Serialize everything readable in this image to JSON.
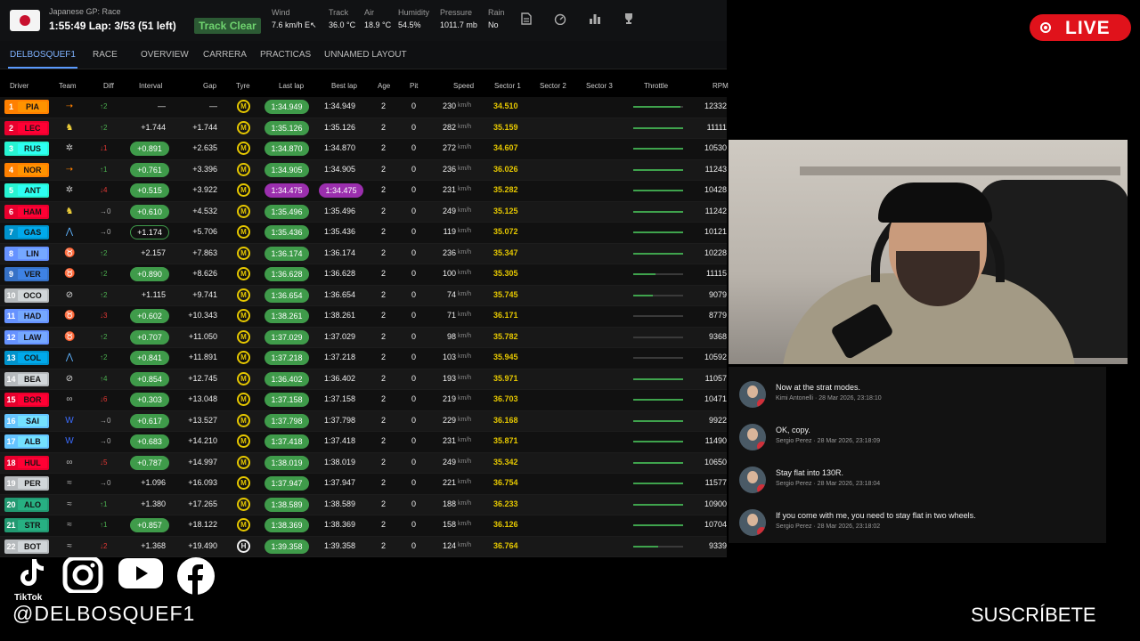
{
  "header": {
    "session": "Japanese GP: Race",
    "lap_info": "1:55:49 Lap: 3/53 (51 left)",
    "track_status": "Track Clear",
    "weather": [
      {
        "label": "Wind",
        "value": "7.6 km/h E↖"
      },
      {
        "label": "Track",
        "value": "36.0 °C"
      },
      {
        "label": "Air",
        "value": "18.9 °C"
      },
      {
        "label": "Humidity",
        "value": "54.5%"
      },
      {
        "label": "Pressure",
        "value": "1011.7 mb"
      },
      {
        "label": "Rain",
        "value": "No"
      }
    ],
    "icons": [
      "document-icon",
      "speedometer-icon",
      "bar-chart-icon",
      "trophy-icon"
    ]
  },
  "tabs": [
    "DELBOSQUEF1",
    "RACE",
    "OVERVIEW",
    "CARRERA",
    "PRACTICAS",
    "UNNAMED LAYOUT"
  ],
  "columns": [
    "Driver",
    "Team",
    "Diff",
    "Interval",
    "Gap",
    "Tyre",
    "Last lap",
    "Best lap",
    "Age",
    "Pit",
    "Speed",
    "Sector 1",
    "Sector 2",
    "Sector 3",
    "Throttle",
    "RPM"
  ],
  "speed_unit": "km/h",
  "rows": [
    {
      "pos": "1",
      "code": "PIA",
      "color": "#ff8000",
      "team_icon": "papaya-wing-icon",
      "diff": "↑2",
      "diff_dir": "up",
      "interval": "—",
      "interval_style": "plain",
      "gap": "—",
      "tyre": "M",
      "last": "1:34.949",
      "last_style": "green",
      "best": "1:34.949",
      "best_style": "plain",
      "age": "2",
      "pit": "0",
      "speed": "230",
      "s1": "34.510",
      "s1_style": "yellow",
      "throttle": 0.95,
      "rpm": "12332"
    },
    {
      "pos": "2",
      "code": "LEC",
      "color": "#e8002d",
      "team_icon": "prancing-horse-icon",
      "diff": "↑2",
      "diff_dir": "up",
      "interval": "+1.744",
      "interval_style": "plain",
      "gap": "+1.744",
      "tyre": "M",
      "last": "1:35.126",
      "last_style": "green",
      "best": "1:35.126",
      "best_style": "plain",
      "age": "2",
      "pit": "0",
      "speed": "282",
      "s1": "35.159",
      "s1_style": "yellow",
      "throttle": 1.0,
      "rpm": "11111"
    },
    {
      "pos": "3",
      "code": "RUS",
      "color": "#27f4d2",
      "team_icon": "star-icon",
      "diff": "↓1",
      "diff_dir": "down",
      "interval": "+0.891",
      "interval_style": "green",
      "gap": "+2.635",
      "tyre": "M",
      "last": "1:34.870",
      "last_style": "green",
      "best": "1:34.870",
      "best_style": "plain",
      "age": "2",
      "pit": "0",
      "speed": "272",
      "s1": "34.607",
      "s1_style": "yellow",
      "throttle": 1.0,
      "rpm": "10530"
    },
    {
      "pos": "4",
      "code": "NOR",
      "color": "#ff8000",
      "team_icon": "papaya-wing-icon",
      "diff": "↑1",
      "diff_dir": "up",
      "interval": "+0.761",
      "interval_style": "green",
      "gap": "+3.396",
      "tyre": "M",
      "last": "1:34.905",
      "last_style": "green",
      "best": "1:34.905",
      "best_style": "plain",
      "age": "2",
      "pit": "0",
      "speed": "236",
      "s1": "36.026",
      "s1_style": "yellow",
      "throttle": 1.0,
      "rpm": "11243"
    },
    {
      "pos": "5",
      "code": "ANT",
      "color": "#27f4d2",
      "team_icon": "star-icon",
      "diff": "↓4",
      "diff_dir": "down",
      "interval": "+0.515",
      "interval_style": "green",
      "gap": "+3.922",
      "tyre": "M",
      "last": "1:34.475",
      "last_style": "purple",
      "best": "1:34.475",
      "best_style": "purple",
      "age": "2",
      "pit": "0",
      "speed": "231",
      "s1": "35.282",
      "s1_style": "yellow",
      "throttle": 1.0,
      "rpm": "10428"
    },
    {
      "pos": "6",
      "code": "HAM",
      "color": "#e8002d",
      "team_icon": "prancing-horse-icon",
      "diff": "→0",
      "diff_dir": "same",
      "interval": "+0.610",
      "interval_style": "green",
      "gap": "+4.532",
      "tyre": "M",
      "last": "1:35.496",
      "last_style": "green",
      "best": "1:35.496",
      "best_style": "plain",
      "age": "2",
      "pit": "0",
      "speed": "249",
      "s1": "35.125",
      "s1_style": "yellow",
      "throttle": 1.0,
      "rpm": "11242"
    },
    {
      "pos": "7",
      "code": "GAS",
      "color": "#0093cc",
      "team_icon": "alpine-icon",
      "diff": "→0",
      "diff_dir": "same",
      "interval": "+1.174",
      "interval_style": "outline",
      "gap": "+5.706",
      "tyre": "M",
      "last": "1:35.436",
      "last_style": "green",
      "best": "1:35.436",
      "best_style": "plain",
      "age": "2",
      "pit": "0",
      "speed": "119",
      "s1": "35.072",
      "s1_style": "yellow",
      "throttle": 1.0,
      "rpm": "10121"
    },
    {
      "pos": "8",
      "code": "LIN",
      "color": "#6692ff",
      "team_icon": "bull-icon",
      "diff": "↑2",
      "diff_dir": "up",
      "interval": "+2.157",
      "interval_style": "plain",
      "gap": "+7.863",
      "tyre": "M",
      "last": "1:36.174",
      "last_style": "green",
      "best": "1:36.174",
      "best_style": "plain",
      "age": "2",
      "pit": "0",
      "speed": "236",
      "s1": "35.347",
      "s1_style": "yellow",
      "throttle": 1.0,
      "rpm": "10228"
    },
    {
      "pos": "9",
      "code": "VER",
      "color": "#3671c6",
      "team_icon": "bull-icon",
      "diff": "↑2",
      "diff_dir": "up",
      "interval": "+0.890",
      "interval_style": "green",
      "gap": "+8.626",
      "tyre": "M",
      "last": "1:36.628",
      "last_style": "green",
      "best": "1:36.628",
      "best_style": "plain",
      "age": "2",
      "pit": "0",
      "speed": "100",
      "s1": "35.305",
      "s1_style": "yellow",
      "throttle": 0.45,
      "rpm": "11115"
    },
    {
      "pos": "10",
      "code": "OCO",
      "color": "#b6babd",
      "team_icon": "haas-icon",
      "diff": "↑2",
      "diff_dir": "up",
      "interval": "+1.115",
      "interval_style": "plain",
      "gap": "+9.741",
      "tyre": "M",
      "last": "1:36.654",
      "last_style": "green",
      "best": "1:36.654",
      "best_style": "plain",
      "age": "2",
      "pit": "0",
      "speed": "74",
      "s1": "35.745",
      "s1_style": "yellow",
      "throttle": 0.4,
      "rpm": "9079"
    },
    {
      "pos": "11",
      "code": "HAD",
      "color": "#6692ff",
      "team_icon": "bull-icon",
      "diff": "↓3",
      "diff_dir": "down",
      "interval": "+0.602",
      "interval_style": "green",
      "gap": "+10.343",
      "tyre": "M",
      "last": "1:38.261",
      "last_style": "green",
      "best": "1:38.261",
      "best_style": "plain",
      "age": "2",
      "pit": "0",
      "speed": "71",
      "s1": "36.171",
      "s1_style": "yellow",
      "throttle": 0.0,
      "rpm": "8779"
    },
    {
      "pos": "12",
      "code": "LAW",
      "color": "#6692ff",
      "team_icon": "bull-icon",
      "diff": "↑2",
      "diff_dir": "up",
      "interval": "+0.707",
      "interval_style": "green",
      "gap": "+11.050",
      "tyre": "M",
      "last": "1:37.029",
      "last_style": "green",
      "best": "1:37.029",
      "best_style": "plain",
      "age": "2",
      "pit": "0",
      "speed": "98",
      "s1": "35.782",
      "s1_style": "yellow",
      "throttle": 0.0,
      "rpm": "9368"
    },
    {
      "pos": "13",
      "code": "COL",
      "color": "#0093cc",
      "team_icon": "alpine-icon",
      "diff": "↑2",
      "diff_dir": "up",
      "interval": "+0.841",
      "interval_style": "green",
      "gap": "+11.891",
      "tyre": "M",
      "last": "1:37.218",
      "last_style": "green",
      "best": "1:37.218",
      "best_style": "plain",
      "age": "2",
      "pit": "0",
      "speed": "103",
      "s1": "35.945",
      "s1_style": "yellow",
      "throttle": 0.0,
      "rpm": "10592"
    },
    {
      "pos": "14",
      "code": "BEA",
      "color": "#b6babd",
      "team_icon": "haas-icon",
      "diff": "↑4",
      "diff_dir": "up",
      "interval": "+0.854",
      "interval_style": "green",
      "gap": "+12.745",
      "tyre": "M",
      "last": "1:36.402",
      "last_style": "green",
      "best": "1:36.402",
      "best_style": "plain",
      "age": "2",
      "pit": "0",
      "speed": "193",
      "s1": "35.971",
      "s1_style": "yellow",
      "throttle": 1.0,
      "rpm": "11057"
    },
    {
      "pos": "15",
      "code": "BOR",
      "color": "#e8002d",
      "team_icon": "audi-icon",
      "diff": "↓6",
      "diff_dir": "down",
      "interval": "+0.303",
      "interval_style": "green",
      "gap": "+13.048",
      "tyre": "M",
      "last": "1:37.158",
      "last_style": "green",
      "best": "1:37.158",
      "best_style": "plain",
      "age": "2",
      "pit": "0",
      "speed": "219",
      "s1": "36.703",
      "s1_style": "yellow",
      "throttle": 1.0,
      "rpm": "10471"
    },
    {
      "pos": "16",
      "code": "SAI",
      "color": "#64c4ff",
      "team_icon": "williams-icon",
      "diff": "→0",
      "diff_dir": "same",
      "interval": "+0.617",
      "interval_style": "green",
      "gap": "+13.527",
      "tyre": "M",
      "last": "1:37.798",
      "last_style": "green",
      "best": "1:37.798",
      "best_style": "plain",
      "age": "2",
      "pit": "0",
      "speed": "229",
      "s1": "36.168",
      "s1_style": "yellow",
      "throttle": 1.0,
      "rpm": "9922"
    },
    {
      "pos": "17",
      "code": "ALB",
      "color": "#64c4ff",
      "team_icon": "williams-icon",
      "diff": "→0",
      "diff_dir": "same",
      "interval": "+0.683",
      "interval_style": "green",
      "gap": "+14.210",
      "tyre": "M",
      "last": "1:37.418",
      "last_style": "green",
      "best": "1:37.418",
      "best_style": "plain",
      "age": "2",
      "pit": "0",
      "speed": "231",
      "s1": "35.871",
      "s1_style": "yellow",
      "throttle": 1.0,
      "rpm": "11490"
    },
    {
      "pos": "18",
      "code": "HUL",
      "color": "#e8002d",
      "team_icon": "audi-icon",
      "diff": "↓5",
      "diff_dir": "down",
      "interval": "+0.787",
      "interval_style": "green",
      "gap": "+14.997",
      "tyre": "M",
      "last": "1:38.019",
      "last_style": "green",
      "best": "1:38.019",
      "best_style": "plain",
      "age": "2",
      "pit": "0",
      "speed": "249",
      "s1": "35.342",
      "s1_style": "yellow",
      "throttle": 1.0,
      "rpm": "10650"
    },
    {
      "pos": "19",
      "code": "PER",
      "color": "#b6babd",
      "team_icon": "cadillac-icon",
      "diff": "→0",
      "diff_dir": "same",
      "interval": "+1.096",
      "interval_style": "plain",
      "gap": "+16.093",
      "tyre": "M",
      "last": "1:37.947",
      "last_style": "green",
      "best": "1:37.947",
      "best_style": "plain",
      "age": "2",
      "pit": "0",
      "speed": "221",
      "s1": "36.754",
      "s1_style": "yellow",
      "throttle": 1.0,
      "rpm": "11577"
    },
    {
      "pos": "20",
      "code": "ALO",
      "color": "#229971",
      "team_icon": "aston-wing-icon",
      "diff": "↑1",
      "diff_dir": "up",
      "interval": "+1.380",
      "interval_style": "plain",
      "gap": "+17.265",
      "tyre": "M",
      "last": "1:38.589",
      "last_style": "green",
      "best": "1:38.589",
      "best_style": "plain",
      "age": "2",
      "pit": "0",
      "speed": "188",
      "s1": "36.233",
      "s1_style": "yellow",
      "throttle": 1.0,
      "rpm": "10900"
    },
    {
      "pos": "21",
      "code": "STR",
      "color": "#229971",
      "team_icon": "aston-wing-icon",
      "diff": "↑1",
      "diff_dir": "up",
      "interval": "+0.857",
      "interval_style": "green",
      "gap": "+18.122",
      "tyre": "M",
      "last": "1:38.369",
      "last_style": "green",
      "best": "1:38.369",
      "best_style": "plain",
      "age": "2",
      "pit": "0",
      "speed": "158",
      "s1": "36.126",
      "s1_style": "yellow",
      "throttle": 1.0,
      "rpm": "10704"
    },
    {
      "pos": "22",
      "code": "BOT",
      "color": "#b6babd",
      "team_icon": "cadillac-icon",
      "diff": "↓2",
      "diff_dir": "down",
      "interval": "+1.368",
      "interval_style": "plain",
      "gap": "+19.490",
      "tyre": "H",
      "last": "1:39.358",
      "last_style": "green",
      "best": "1:39.358",
      "best_style": "plain",
      "age": "2",
      "pit": "0",
      "speed": "124",
      "s1": "36.764",
      "s1_style": "yellow",
      "throttle": 0.5,
      "rpm": "9339"
    }
  ],
  "chat": [
    {
      "text": "Now at the strat modes.",
      "meta": "Kimi Antonelli · 28 Mar 2026, 23:18:10"
    },
    {
      "text": "OK, copy.",
      "meta": "Sergio Perez · 28 Mar 2026, 23:18:09"
    },
    {
      "text": "Stay flat into 130R.",
      "meta": "Sergio Perez · 28 Mar 2026, 23:18:04"
    },
    {
      "text": "If you come with me, you need to stay flat in two wheels.",
      "meta": "Sergio Perez · 28 Mar 2026, 23:18:02"
    }
  ],
  "live_label": "LIVE",
  "socials": {
    "tiktok_label": "TikTok",
    "handle": "@DELBOSQUEF1",
    "subscribe": "SUSCRÍBETE"
  },
  "colors": {
    "green_pill": "#3f9b4a",
    "purple_pill": "#9b2fae",
    "sector_yellow": "#e6c800",
    "live_red": "#e0121b"
  }
}
